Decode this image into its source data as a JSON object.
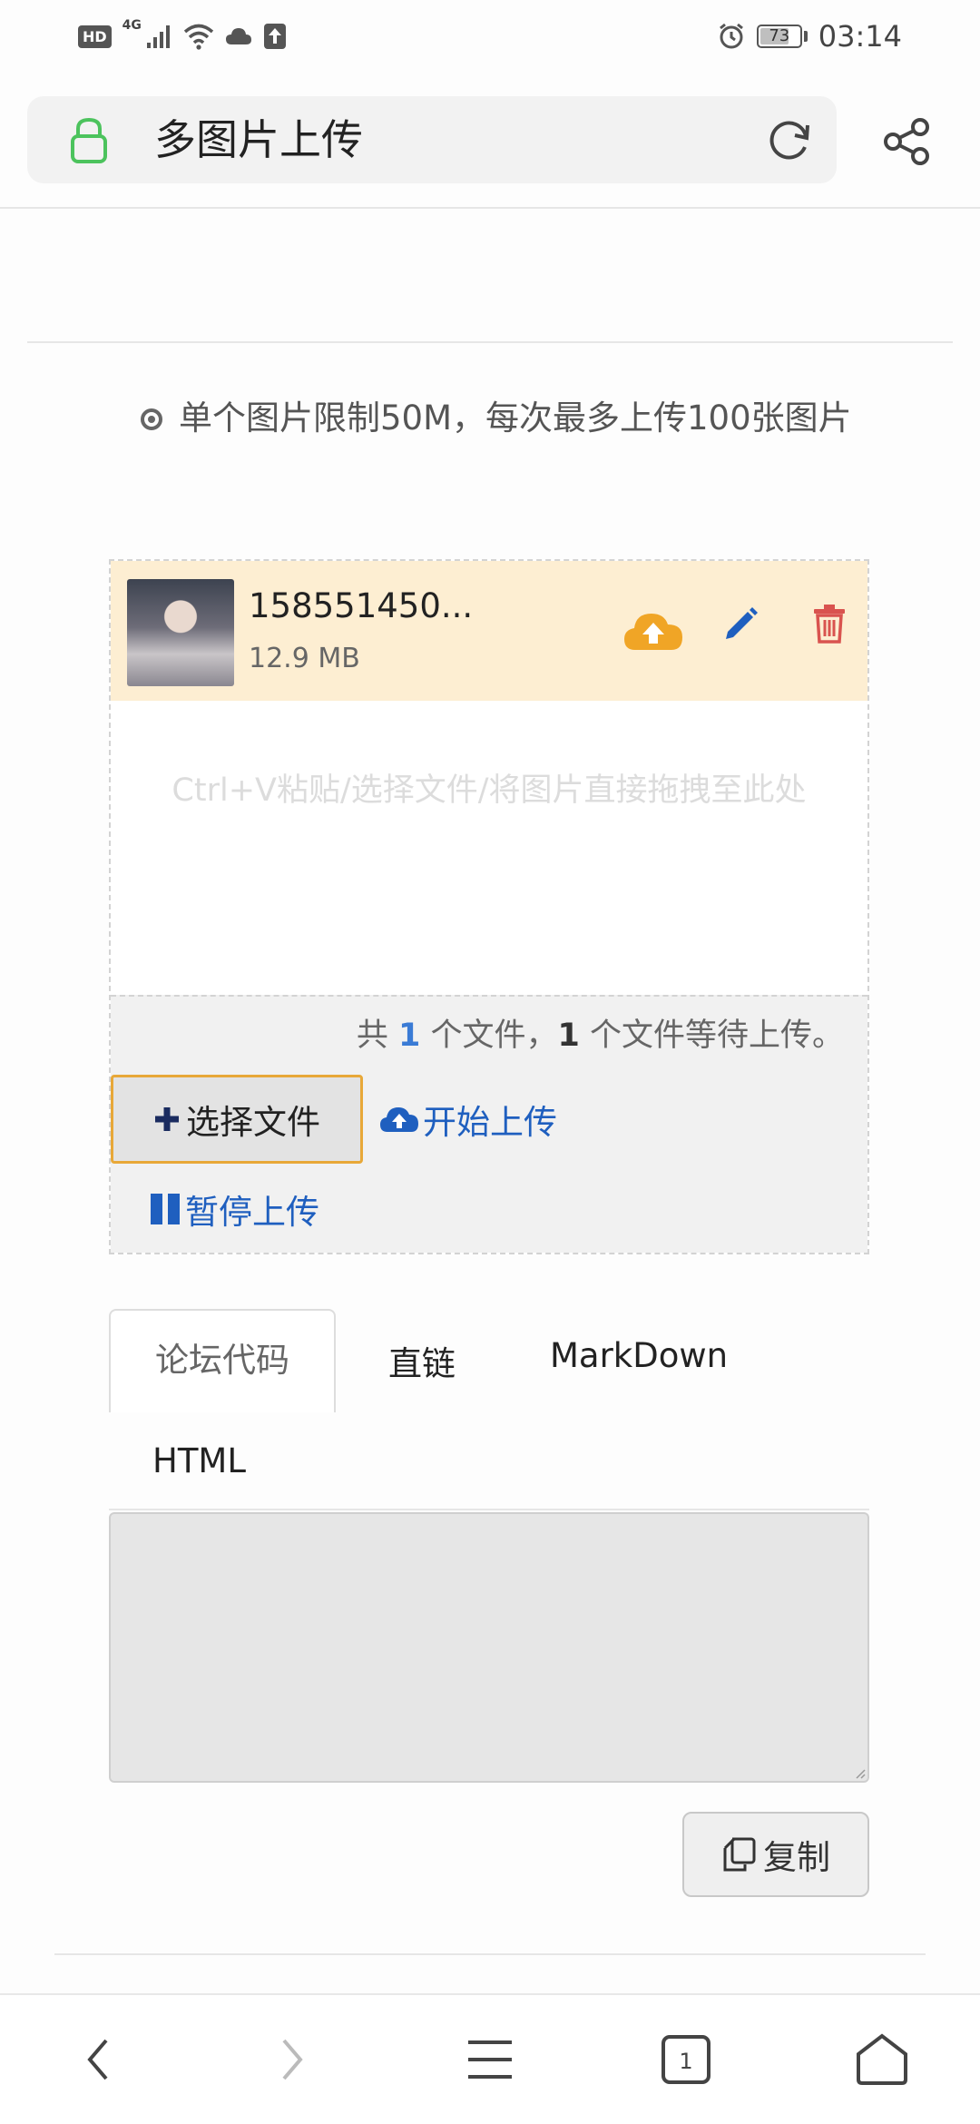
{
  "status_bar": {
    "hd": "HD",
    "network": "4G",
    "battery": "73",
    "battery_level": 0.73,
    "time": "03:14",
    "icons": [
      "signal-icon",
      "wifi-icon",
      "cloud-icon",
      "upload-status-icon",
      "alarm-icon",
      "battery-icon"
    ]
  },
  "address_bar": {
    "title": "多图片上传",
    "icons": [
      "lock-icon",
      "refresh-icon",
      "share-icon"
    ]
  },
  "notice": "单个图片限制50M，每次最多上传100张图片",
  "uploader": {
    "file": {
      "name": "158551450...",
      "size": "12.9 MB"
    },
    "drop_hint": "Ctrl+V粘贴/选择文件/将图片直接拖拽至此处",
    "status": {
      "prefix": "共",
      "total": "1",
      "middle": "个文件，",
      "waiting": "1",
      "suffix": "个文件等待上传。"
    },
    "buttons": {
      "select": "选择文件",
      "start": "开始上传",
      "pause": "暂停上传"
    }
  },
  "tabs": [
    "论坛代码",
    "直链",
    "MarkDown",
    "HTML"
  ],
  "active_tab": "论坛代码",
  "code_output": "",
  "copy_button": "复制",
  "bottom_nav": {
    "tab_count": "1",
    "icons": [
      "back-icon",
      "forward-icon",
      "menu-icon",
      "tabs-icon",
      "home-icon"
    ]
  },
  "colors": {
    "accent_blue": "#1f5fbf",
    "highlight_orange": "#e8a838",
    "file_row_bg": "#fdeed2",
    "delete_red": "#d9534f",
    "lock_green": "#4cc35d"
  }
}
